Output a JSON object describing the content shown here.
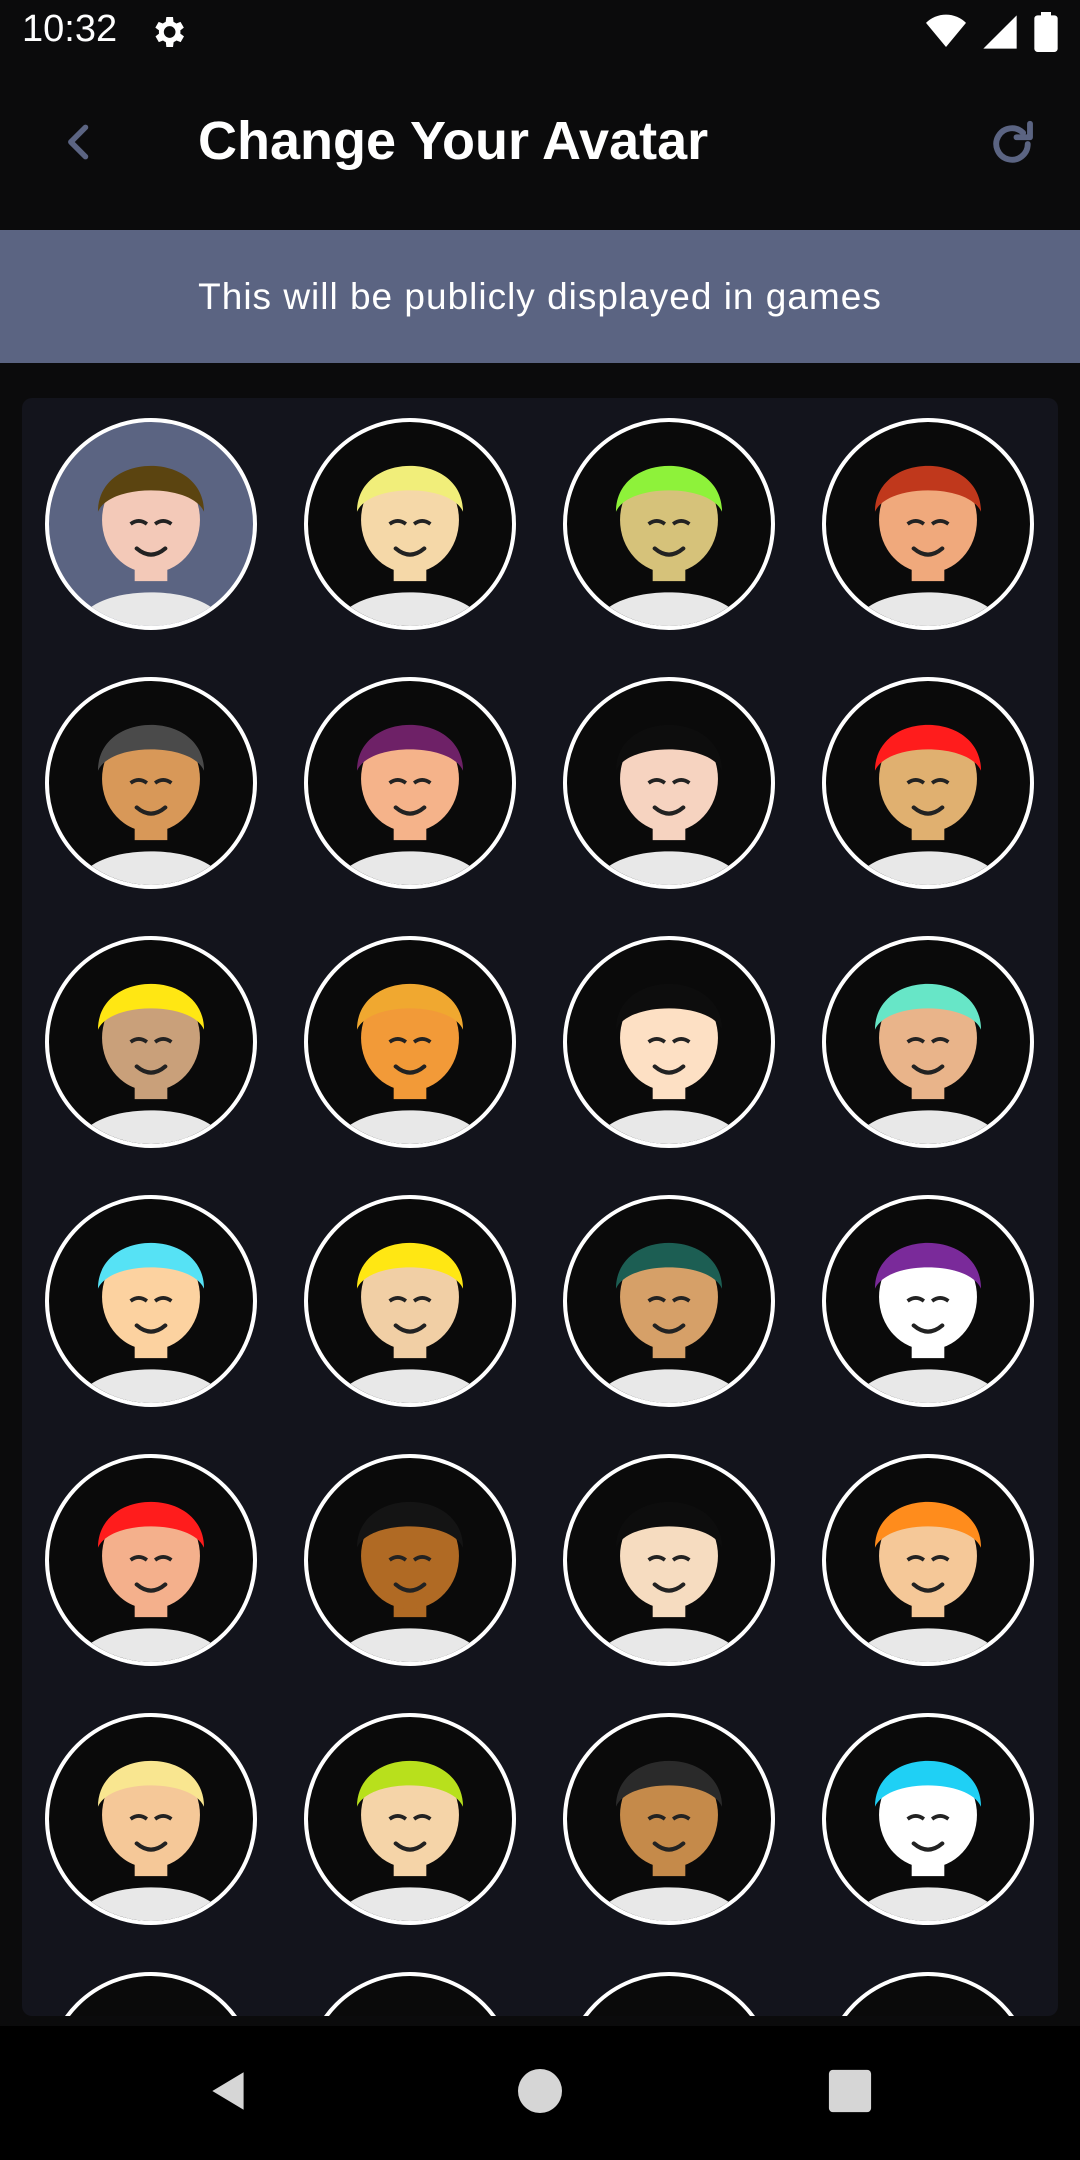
{
  "status_bar": {
    "time": "10:32",
    "icons": [
      "gear-icon",
      "wifi-icon",
      "signal-icon",
      "battery-icon"
    ]
  },
  "app_bar": {
    "title": "Change Your Avatar",
    "back_icon": "chevron-left-icon",
    "refresh_icon": "refresh-icon"
  },
  "banner": {
    "text": "This will be publicly displayed in games"
  },
  "colors": {
    "banner_bg": "#5b6482",
    "panel_bg": "#13141c",
    "accent_icon": "#5b6482",
    "selected_avatar_bg": "#5b6482"
  },
  "avatars": [
    {
      "id": 1,
      "desc": "hat-sunglasses",
      "skin": "#f3c9b8",
      "hair": "#5b4410",
      "bg": "#5b6482",
      "selected": true
    },
    {
      "id": 2,
      "desc": "fedora-blond",
      "skin": "#f5d8a8",
      "hair": "#f1ee7a",
      "bg": "#0a0a0a"
    },
    {
      "id": 3,
      "desc": "green-hair",
      "skin": "#d6c27a",
      "hair": "#8ef23a",
      "bg": "#0a0a0a"
    },
    {
      "id": 4,
      "desc": "masked-antenna",
      "skin": "#f0a97c",
      "hair": "#c0381c",
      "bg": "#0a0a0a"
    },
    {
      "id": 5,
      "desc": "grey-hat",
      "skin": "#d89858",
      "hair": "#4a4a4a",
      "bg": "#0a0a0a"
    },
    {
      "id": 6,
      "desc": "purple-hair-mask",
      "skin": "#f5b38a",
      "hair": "#6e2167",
      "bg": "#0a0a0a"
    },
    {
      "id": 7,
      "desc": "curly-black",
      "skin": "#f6d3c0",
      "hair": "#0d0d0d",
      "bg": "#0a0a0a"
    },
    {
      "id": 8,
      "desc": "red-hair",
      "skin": "#e0b070",
      "hair": "#ff1c1c",
      "bg": "#0a0a0a"
    },
    {
      "id": 9,
      "desc": "yellow-long-hair",
      "skin": "#c9a07a",
      "hair": "#ffe713",
      "bg": "#0a0a0a"
    },
    {
      "id": 10,
      "desc": "orange-bald",
      "skin": "#f29a38",
      "hair": "#f0a830",
      "bg": "#0a0a0a"
    },
    {
      "id": 11,
      "desc": "flower-girl",
      "skin": "#fde0c4",
      "hair": "#0d0d0d",
      "bg": "#0a0a0a"
    },
    {
      "id": 12,
      "desc": "mint-buns",
      "skin": "#e9b48a",
      "hair": "#67e6c7",
      "bg": "#0a0a0a"
    },
    {
      "id": 13,
      "desc": "cyan-hair",
      "skin": "#fcd2a0",
      "hair": "#56e2f5",
      "bg": "#0a0a0a"
    },
    {
      "id": 14,
      "desc": "crown-glasses",
      "skin": "#f1cfa5",
      "hair": "#ffe713",
      "bg": "#0a0a0a"
    },
    {
      "id": 15,
      "desc": "teal-dreads-mask",
      "skin": "#d6a068",
      "hair": "#1c5e53",
      "bg": "#0a0a0a"
    },
    {
      "id": 16,
      "desc": "purple-curly-shades",
      "skin": "#ffffff",
      "hair": "#7a2a9a",
      "bg": "#0a0a0a"
    },
    {
      "id": 17,
      "desc": "red-quiff",
      "skin": "#f4b08c",
      "hair": "#ff1c1c",
      "bg": "#0a0a0a"
    },
    {
      "id": 18,
      "desc": "dark-beard-glasses",
      "skin": "#b06a24",
      "hair": "#141414",
      "bg": "#0a0a0a"
    },
    {
      "id": 19,
      "desc": "black-bob",
      "skin": "#f6dcc0",
      "hair": "#0d0d0d",
      "bg": "#0a0a0a"
    },
    {
      "id": 20,
      "desc": "orange-quiff",
      "skin": "#f5c898",
      "hair": "#ff8c1c",
      "bg": "#0a0a0a"
    },
    {
      "id": 21,
      "desc": "blond-dreads-glasses",
      "skin": "#f5c898",
      "hair": "#f9e690",
      "bg": "#0a0a0a"
    },
    {
      "id": 22,
      "desc": "green-mohawk",
      "skin": "#f5d4a8",
      "hair": "#b8e01c",
      "bg": "#0a0a0a"
    },
    {
      "id": 23,
      "desc": "grey-dreads-glasses",
      "skin": "#c58a4a",
      "hair": "#2a2a2a",
      "bg": "#0a0a0a"
    },
    {
      "id": 24,
      "desc": "cyan-ponytail",
      "skin": "#ffffff",
      "hair": "#1fd0f5",
      "bg": "#0a0a0a"
    },
    {
      "id": 25,
      "desc": "partial-1",
      "skin": "#f6dcc0",
      "hair": "#111111",
      "bg": "#0a0a0a"
    },
    {
      "id": 26,
      "desc": "partial-2",
      "skin": "#f6dcc0",
      "hair": "#f9e690",
      "bg": "#0a0a0a"
    },
    {
      "id": 27,
      "desc": "partial-3",
      "skin": "#f6dcc0",
      "hair": "#111111",
      "bg": "#0a0a0a"
    },
    {
      "id": 28,
      "desc": "partial-4",
      "skin": "#f6dcc0",
      "hair": "#ffffff",
      "bg": "#0a0a0a"
    }
  ],
  "nav_bar": {
    "buttons": [
      "back-triangle-icon",
      "home-circle-icon",
      "recents-square-icon"
    ]
  }
}
